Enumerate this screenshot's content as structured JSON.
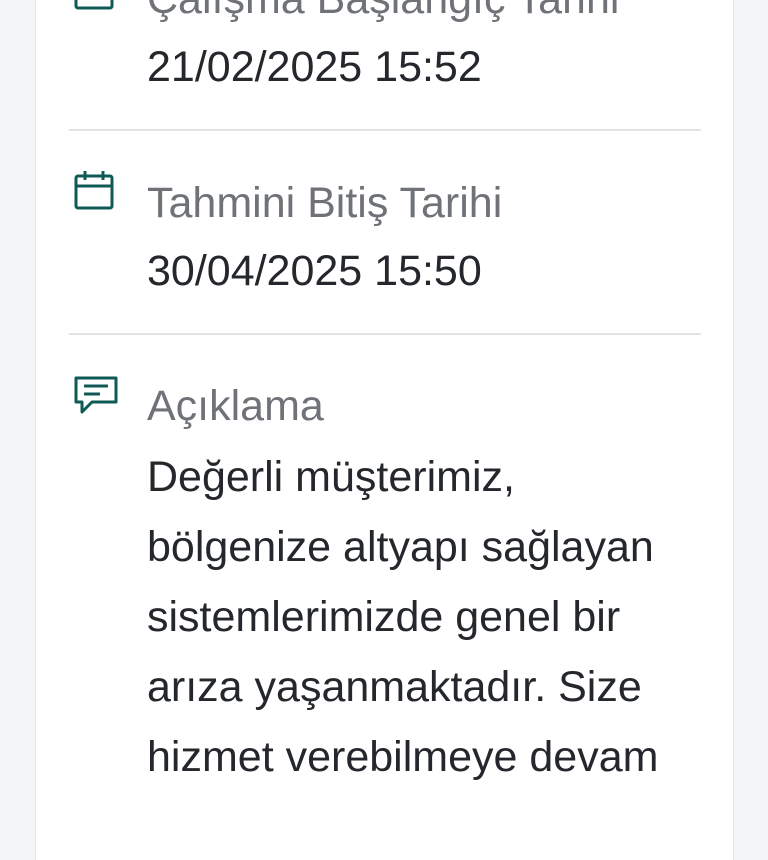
{
  "items": [
    {
      "label": "Çalışma Başlangıç Tarihi",
      "value": "21/02/2025 15:52",
      "icon": "calendar-icon"
    },
    {
      "label": "Tahmini Bitiş Tarihi",
      "value": "30/04/2025 15:50",
      "icon": "calendar-icon"
    }
  ],
  "description": {
    "label": "Açıklama",
    "icon": "comment-icon",
    "lines": [
      "Değerli müşterimiz,",
      "bölgenize altyapı sağlayan",
      "sistemlerimizde genel bir",
      "arıza yaşanmaktadır. Size",
      "hizmet verebilmeye devam"
    ]
  },
  "colors": {
    "accent": "#0f5a56",
    "label": "#6f7378",
    "value": "#24272b",
    "divider": "#e2e4e7"
  }
}
